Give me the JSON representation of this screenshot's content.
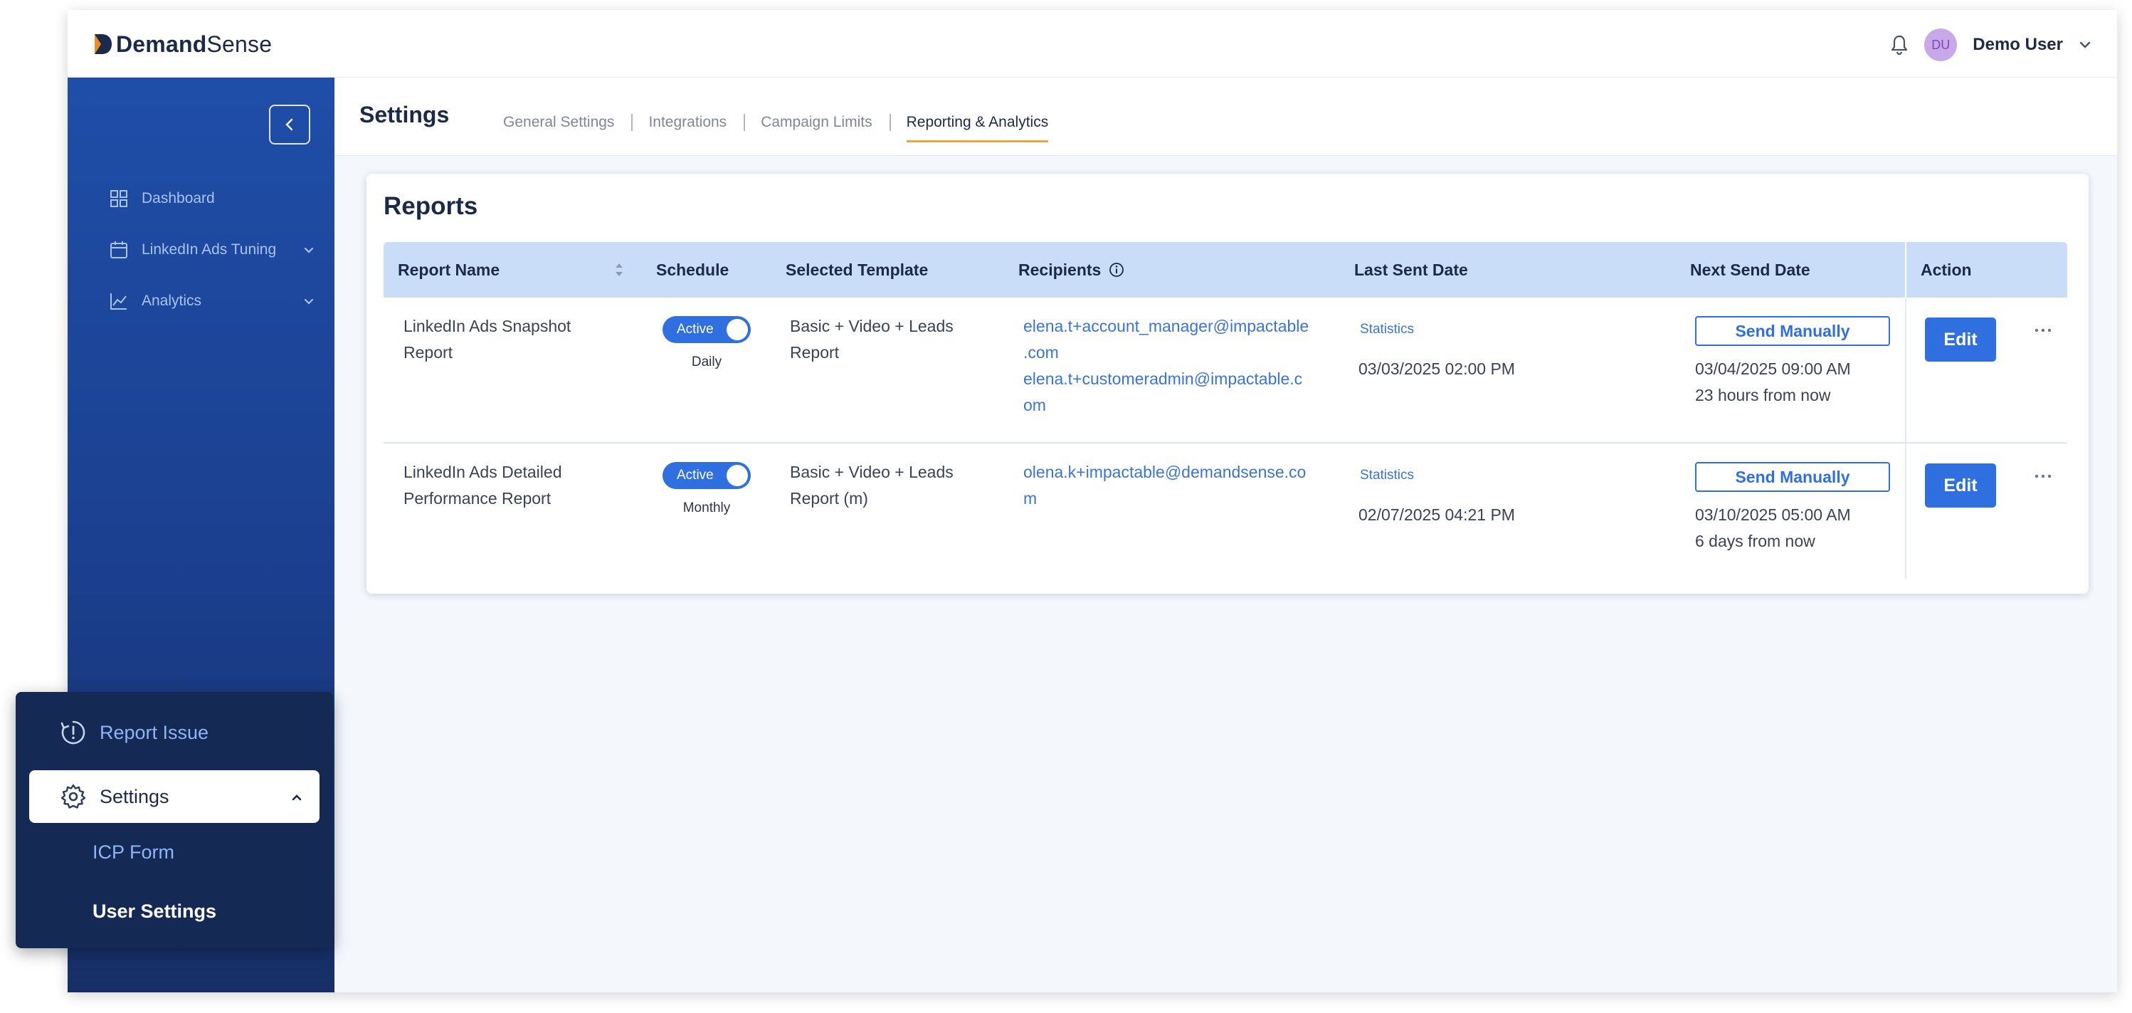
{
  "brand": {
    "name_bold": "Demand",
    "name_regular": "Sense"
  },
  "header": {
    "avatar_initials": "DU",
    "user_name": "Demo User"
  },
  "sidebar": {
    "items": [
      {
        "label": "Dashboard",
        "icon": "grid-icon"
      },
      {
        "label": "LinkedIn Ads Tuning",
        "icon": "calendar-icon"
      },
      {
        "label": "Analytics",
        "icon": "line-chart-icon"
      }
    ]
  },
  "settings_page": {
    "title": "Settings",
    "tabs": [
      {
        "label": "General Settings",
        "active": false
      },
      {
        "label": "Integrations",
        "active": false
      },
      {
        "label": "Campaign Limits",
        "active": false
      },
      {
        "label": "Reporting & Analytics",
        "active": true
      }
    ]
  },
  "reports": {
    "title": "Reports",
    "columns": {
      "report_name": "Report Name",
      "schedule": "Schedule",
      "selected_template": "Selected Template",
      "recipients": "Recipients",
      "last_sent_date": "Last Sent Date",
      "next_send_date": "Next Send Date",
      "action": "Action"
    },
    "rows": [
      {
        "name_line1": "LinkedIn Ads Snapshot",
        "name_line2": "Report",
        "status": "Active",
        "frequency": "Daily",
        "template_line1": "Basic + Video + Leads",
        "template_line2": "Report",
        "recipients_lines": [
          "elena.t+account_manager@impactable",
          ".com",
          "elena.t+customeradmin@impactable.c",
          "om"
        ],
        "statistics_label": "Statistics",
        "last_sent": "03/03/2025 02:00 PM",
        "send_manually_label": "Send Manually",
        "next_send": "03/04/2025 09:00 AM",
        "next_send_relative": "23 hours from now",
        "edit_label": "Edit"
      },
      {
        "name_line1": "LinkedIn Ads Detailed",
        "name_line2": "Performance Report",
        "status": "Active",
        "frequency": "Monthly",
        "template_line1": "Basic + Video + Leads",
        "template_line2": "Report (m)",
        "recipients_lines": [
          "olena.k+impactable@demandsense.co",
          "m"
        ],
        "statistics_label": "Statistics",
        "last_sent": "02/07/2025 04:21 PM",
        "send_manually_label": "Send Manually",
        "next_send": "03/10/2025 05:00 AM",
        "next_send_relative": "6 days from now",
        "edit_label": "Edit"
      }
    ]
  },
  "popover": {
    "report_issue": "Report Issue",
    "settings": "Settings",
    "sub_items": [
      "ICP Form",
      "User Settings"
    ]
  },
  "colors": {
    "sidebar_top": "#1f4ea8",
    "sidebar_bottom": "#172f66",
    "accent_blue": "#2f6fe0",
    "tab_underline": "#f0a33a",
    "table_header": "#c9ddf8"
  }
}
